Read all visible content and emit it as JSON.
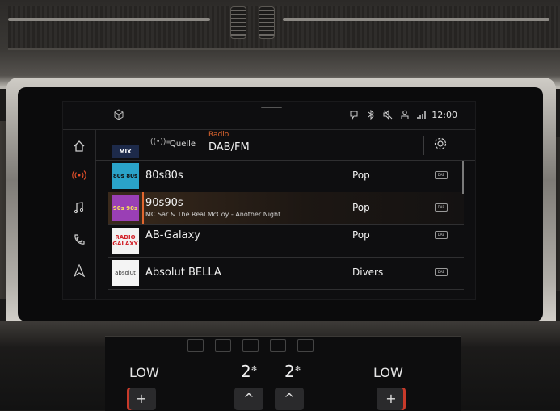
{
  "status": {
    "time": "12:00",
    "icons": [
      "car-settings-icon",
      "navigation-location-icon",
      "bluetooth-icon",
      "mute-icon",
      "user-icon",
      "signal-icon"
    ]
  },
  "sidebar": {
    "items": [
      {
        "icon": "home-icon"
      },
      {
        "icon": "radio-icon",
        "active": true
      },
      {
        "icon": "music-icon"
      },
      {
        "icon": "phone-icon"
      },
      {
        "icon": "navigation-icon"
      }
    ]
  },
  "header": {
    "source_label": "Quelle",
    "category": "Radio",
    "band": "DAB/FM"
  },
  "stations": [
    {
      "name": "",
      "genre": "",
      "logo_text": "MIX",
      "partial": true
    },
    {
      "name": "80s80s",
      "genre": "Pop",
      "logo_text": "80s 80s",
      "badge": "DAB"
    },
    {
      "name": "90s90s",
      "sub": "MC Sar & The Real McCoy - Another Night",
      "genre": "Pop",
      "logo_text": "90s 90s",
      "badge": "DAB",
      "selected": true
    },
    {
      "name": "AB-Galaxy",
      "genre": "Pop",
      "logo_text": "RADIO GALAXY",
      "badge": "DAB"
    },
    {
      "name": "Absolut BELLA",
      "genre": "Divers",
      "logo_text": "absolut",
      "badge": "DAB"
    }
  ],
  "climate": {
    "left_label": "LOW",
    "right_label": "LOW",
    "left_fan": "2",
    "right_fan": "2",
    "up_symbol": "^",
    "plus_symbol": "+"
  },
  "colors": {
    "accent": "#e0662f",
    "background": "#0e0e10"
  }
}
